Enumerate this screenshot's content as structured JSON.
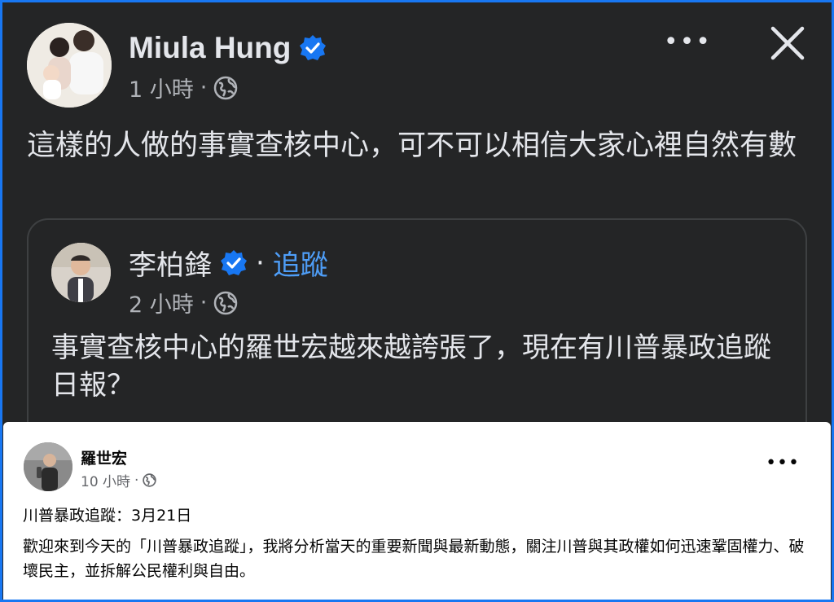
{
  "post": {
    "author": "Miula Hung",
    "time": "1 小時",
    "sep": "·",
    "more": "•••",
    "text": "這樣的人做的事實查核中心，可不可以相信大家心裡自然有數"
  },
  "shared": {
    "author": "李柏鋒",
    "sep": "·",
    "follow": "追蹤",
    "time": "2 小時",
    "text": "事實查核中心的羅世宏越來越誇張了，現在有川普暴政追蹤日報？"
  },
  "embedded": {
    "author": "羅世宏",
    "time": "10 小時",
    "sep": "·",
    "more": "•••",
    "title": "川普暴政追蹤：3月21日",
    "body": "歡迎來到今天的「川普暴政追蹤」，我將分析當天的重要新聞與最新動態，關注川普與其政權如何迅速鞏固權力、破壞民主，並拆解公民權利與自由。"
  },
  "colors": {
    "background": "#242526",
    "verified": "#1877f2",
    "follow": "#4e9ef8",
    "secondary_text": "#b0b3b8"
  },
  "icons": [
    "verified-badge-icon",
    "globe-icon",
    "more-options-icon",
    "close-icon"
  ]
}
